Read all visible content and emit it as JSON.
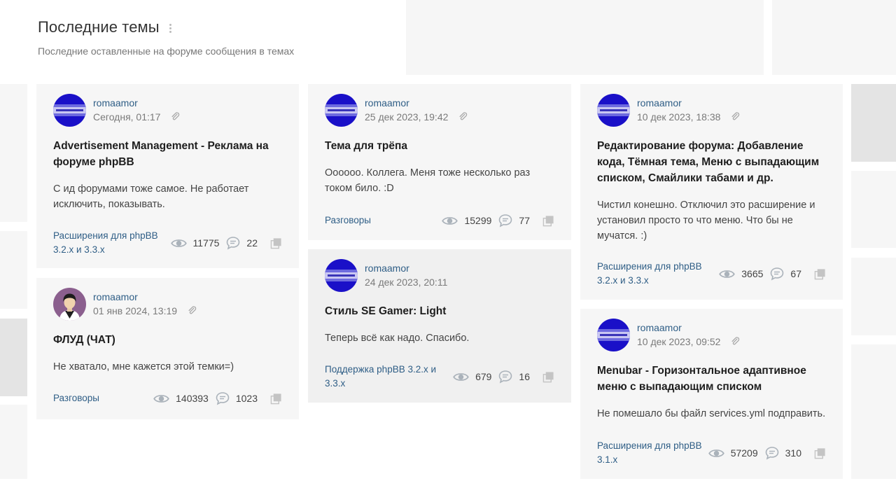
{
  "header": {
    "title": "Последние темы",
    "subtitle": "Последние оставленные на форуме сообщения в темах"
  },
  "colors": {
    "link": "#2f5e86",
    "card_light": "#f6f6f6",
    "card_mid": "#f0f0f0",
    "icon_gray": "#aab2ba"
  },
  "cards": [
    {
      "author": "romaamor",
      "date": "Сегодня, 01:17",
      "avatar": "banner-avatar",
      "title": "Advertisement Management - Реклама на форуме phpBB",
      "excerpt": "С ид форумами тоже самое. Не работает исключить, показывать.",
      "forum": "Расширения для phpBB 3.2.x и 3.3.x",
      "views": "11775",
      "replies": "22"
    },
    {
      "author": "romaamor",
      "date": "01 янв 2024, 13:19",
      "avatar": "person-avatar",
      "title": "ФЛУД (ЧАТ)",
      "excerpt": "Не хватало, мне кажется этой темки=)",
      "forum": "Разговоры",
      "views": "140393",
      "replies": "1023"
    },
    {
      "author": "romaamor",
      "date": "25 дек 2023, 19:42",
      "avatar": "banner-avatar",
      "title": "Тема для трёпа",
      "excerpt": "Оооооо. Коллега. Меня тоже несколько раз током било. :D",
      "forum": "Разговоры",
      "views": "15299",
      "replies": "77"
    },
    {
      "author": "romaamor",
      "date": "24 дек 2023, 20:11",
      "avatar": "banner-avatar",
      "title": "Стиль SE Gamer: Light",
      "excerpt": "Теперь всё как надо. Спасибо.",
      "forum": "Поддержка phpBB 3.2.x и 3.3.x",
      "views": "679",
      "replies": "16"
    },
    {
      "author": "romaamor",
      "date": "10 дек 2023, 18:38",
      "avatar": "banner-avatar",
      "title": "Редактирование форума: Добавление кода, Тёмная тема, Меню с выпадающим списком, Смайлики табами и др.",
      "excerpt": "Чистил конешно. Отключил это расширение и установил просто то что меню. Что бы не мучатся. :)",
      "forum": "Расширения для phpBB 3.2.x и 3.3.x",
      "views": "3665",
      "replies": "67"
    },
    {
      "author": "romaamor",
      "date": "10 дек 2023, 09:52",
      "avatar": "banner-avatar",
      "title": "Menubar - Горизонтальное адаптивное меню с выпадающим списком",
      "excerpt": "Не помешало бы файл services.yml подправить.",
      "forum": "Расширения для phpBB 3.1.x",
      "views": "57209",
      "replies": "310"
    }
  ]
}
